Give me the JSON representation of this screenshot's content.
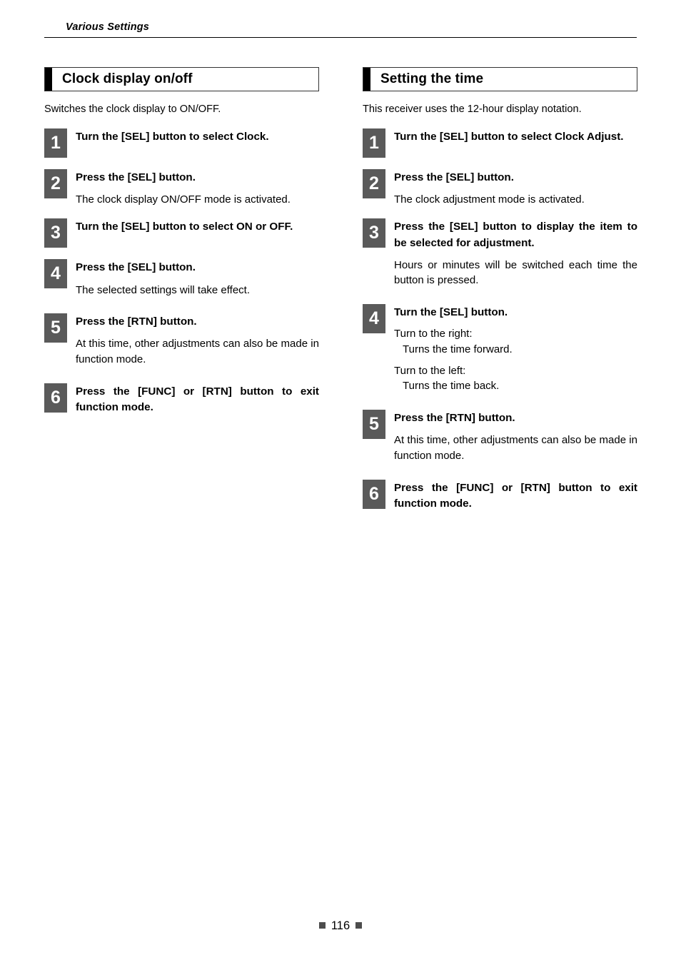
{
  "header": {
    "running_title": "Various Settings"
  },
  "footer": {
    "page_number": "116"
  },
  "sections": [
    {
      "title": "Clock display on/off",
      "intro": "Switches the clock display to ON/OFF.",
      "steps": [
        {
          "number": "1",
          "head": "Turn the [SEL] button to select Clock.",
          "notes": []
        },
        {
          "number": "2",
          "head": "Press the [SEL] button.",
          "notes": [
            "The clock display ON/OFF mode is activated."
          ]
        },
        {
          "number": "3",
          "head": "Turn the [SEL] button to select ON or OFF.",
          "notes": []
        },
        {
          "number": "4",
          "head": "Press the [SEL] button.",
          "notes": [
            "The selected settings will take effect."
          ]
        },
        {
          "number": "5",
          "head": "Press the [RTN] button.",
          "notes": [
            "At this time, other adjustments can also be made in function mode."
          ]
        },
        {
          "number": "6",
          "head": "Press the [FUNC] or [RTN] button to exit function mode.",
          "notes": []
        }
      ]
    },
    {
      "title": "Setting the time",
      "intro": "This receiver uses the 12-hour display notation.",
      "steps": [
        {
          "number": "1",
          "head": "Turn the [SEL] button to select Clock Adjust.",
          "notes": []
        },
        {
          "number": "2",
          "head": "Press the [SEL] button.",
          "notes": [
            "The clock adjustment mode is activated."
          ]
        },
        {
          "number": "3",
          "head": "Press the [SEL] button to display the item to be selected for adjustment.",
          "notes": [
            "Hours or minutes will be switched each time the button is pressed."
          ]
        },
        {
          "number": "4",
          "head": "Turn the [SEL] button.",
          "notes": [
            "Turn to the right:",
            "Turns the time forward.",
            "Turn to the left:",
            "Turns the time back."
          ]
        },
        {
          "number": "5",
          "head": "Press the [RTN] button.",
          "notes": [
            "At this time, other adjustments can also be made in function mode."
          ]
        },
        {
          "number": "6",
          "head": "Press the [FUNC] or [RTN] button to exit function mode.",
          "notes": []
        }
      ]
    }
  ]
}
